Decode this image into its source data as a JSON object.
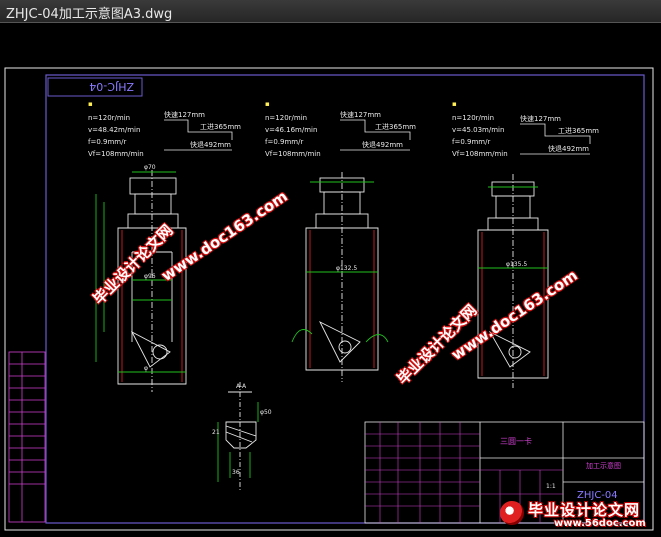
{
  "window": {
    "title": "ZHJC-04加工示意图A3.dwg"
  },
  "drawing": {
    "corner_code": "ZHJC-04",
    "params": [
      {
        "speed": "n=120r/min",
        "velocity": "v=48.42m/min",
        "feed": "f=0.9mm/r",
        "vf": "Vf=108mm/min"
      },
      {
        "speed": "n=120r/min",
        "velocity": "v=46.16m/min",
        "feed": "f=0.9mm/r",
        "vf": "Vf=108mm/min"
      },
      {
        "speed": "n=120r/min",
        "velocity": "v=45.03m/min",
        "feed": "f=0.9mm/r",
        "vf": "Vf=108mm/min"
      }
    ],
    "strokes": [
      {
        "a": "快速127mm",
        "b": "工进365mm",
        "c": "快退492mm"
      },
      {
        "a": "快速127mm",
        "b": "工进365mm",
        "c": "快退492mm"
      },
      {
        "a": "快速127mm",
        "b": "工进365mm",
        "c": "快退492mm"
      }
    ],
    "dims": {
      "d1_top": "φ70",
      "d1_mid": "φ96",
      "d1_low": "φ",
      "d2_mid": "φ132.5",
      "d3_mid": "φ135.5",
      "detail_a": "A-A",
      "detail_w": "φ50",
      "detail_dim1": "21",
      "detail_dim2": "36"
    },
    "title_block": {
      "part_name": "三圆一卡",
      "drawing_name": "加工示意图",
      "code": "ZHJC-04",
      "scale": "1:1"
    }
  },
  "watermarks": {
    "site": "www.doc163.com",
    "cn": "毕业设计论文网"
  },
  "logo": {
    "text": "毕业设计论文网",
    "url": "www.56doc.com"
  }
}
